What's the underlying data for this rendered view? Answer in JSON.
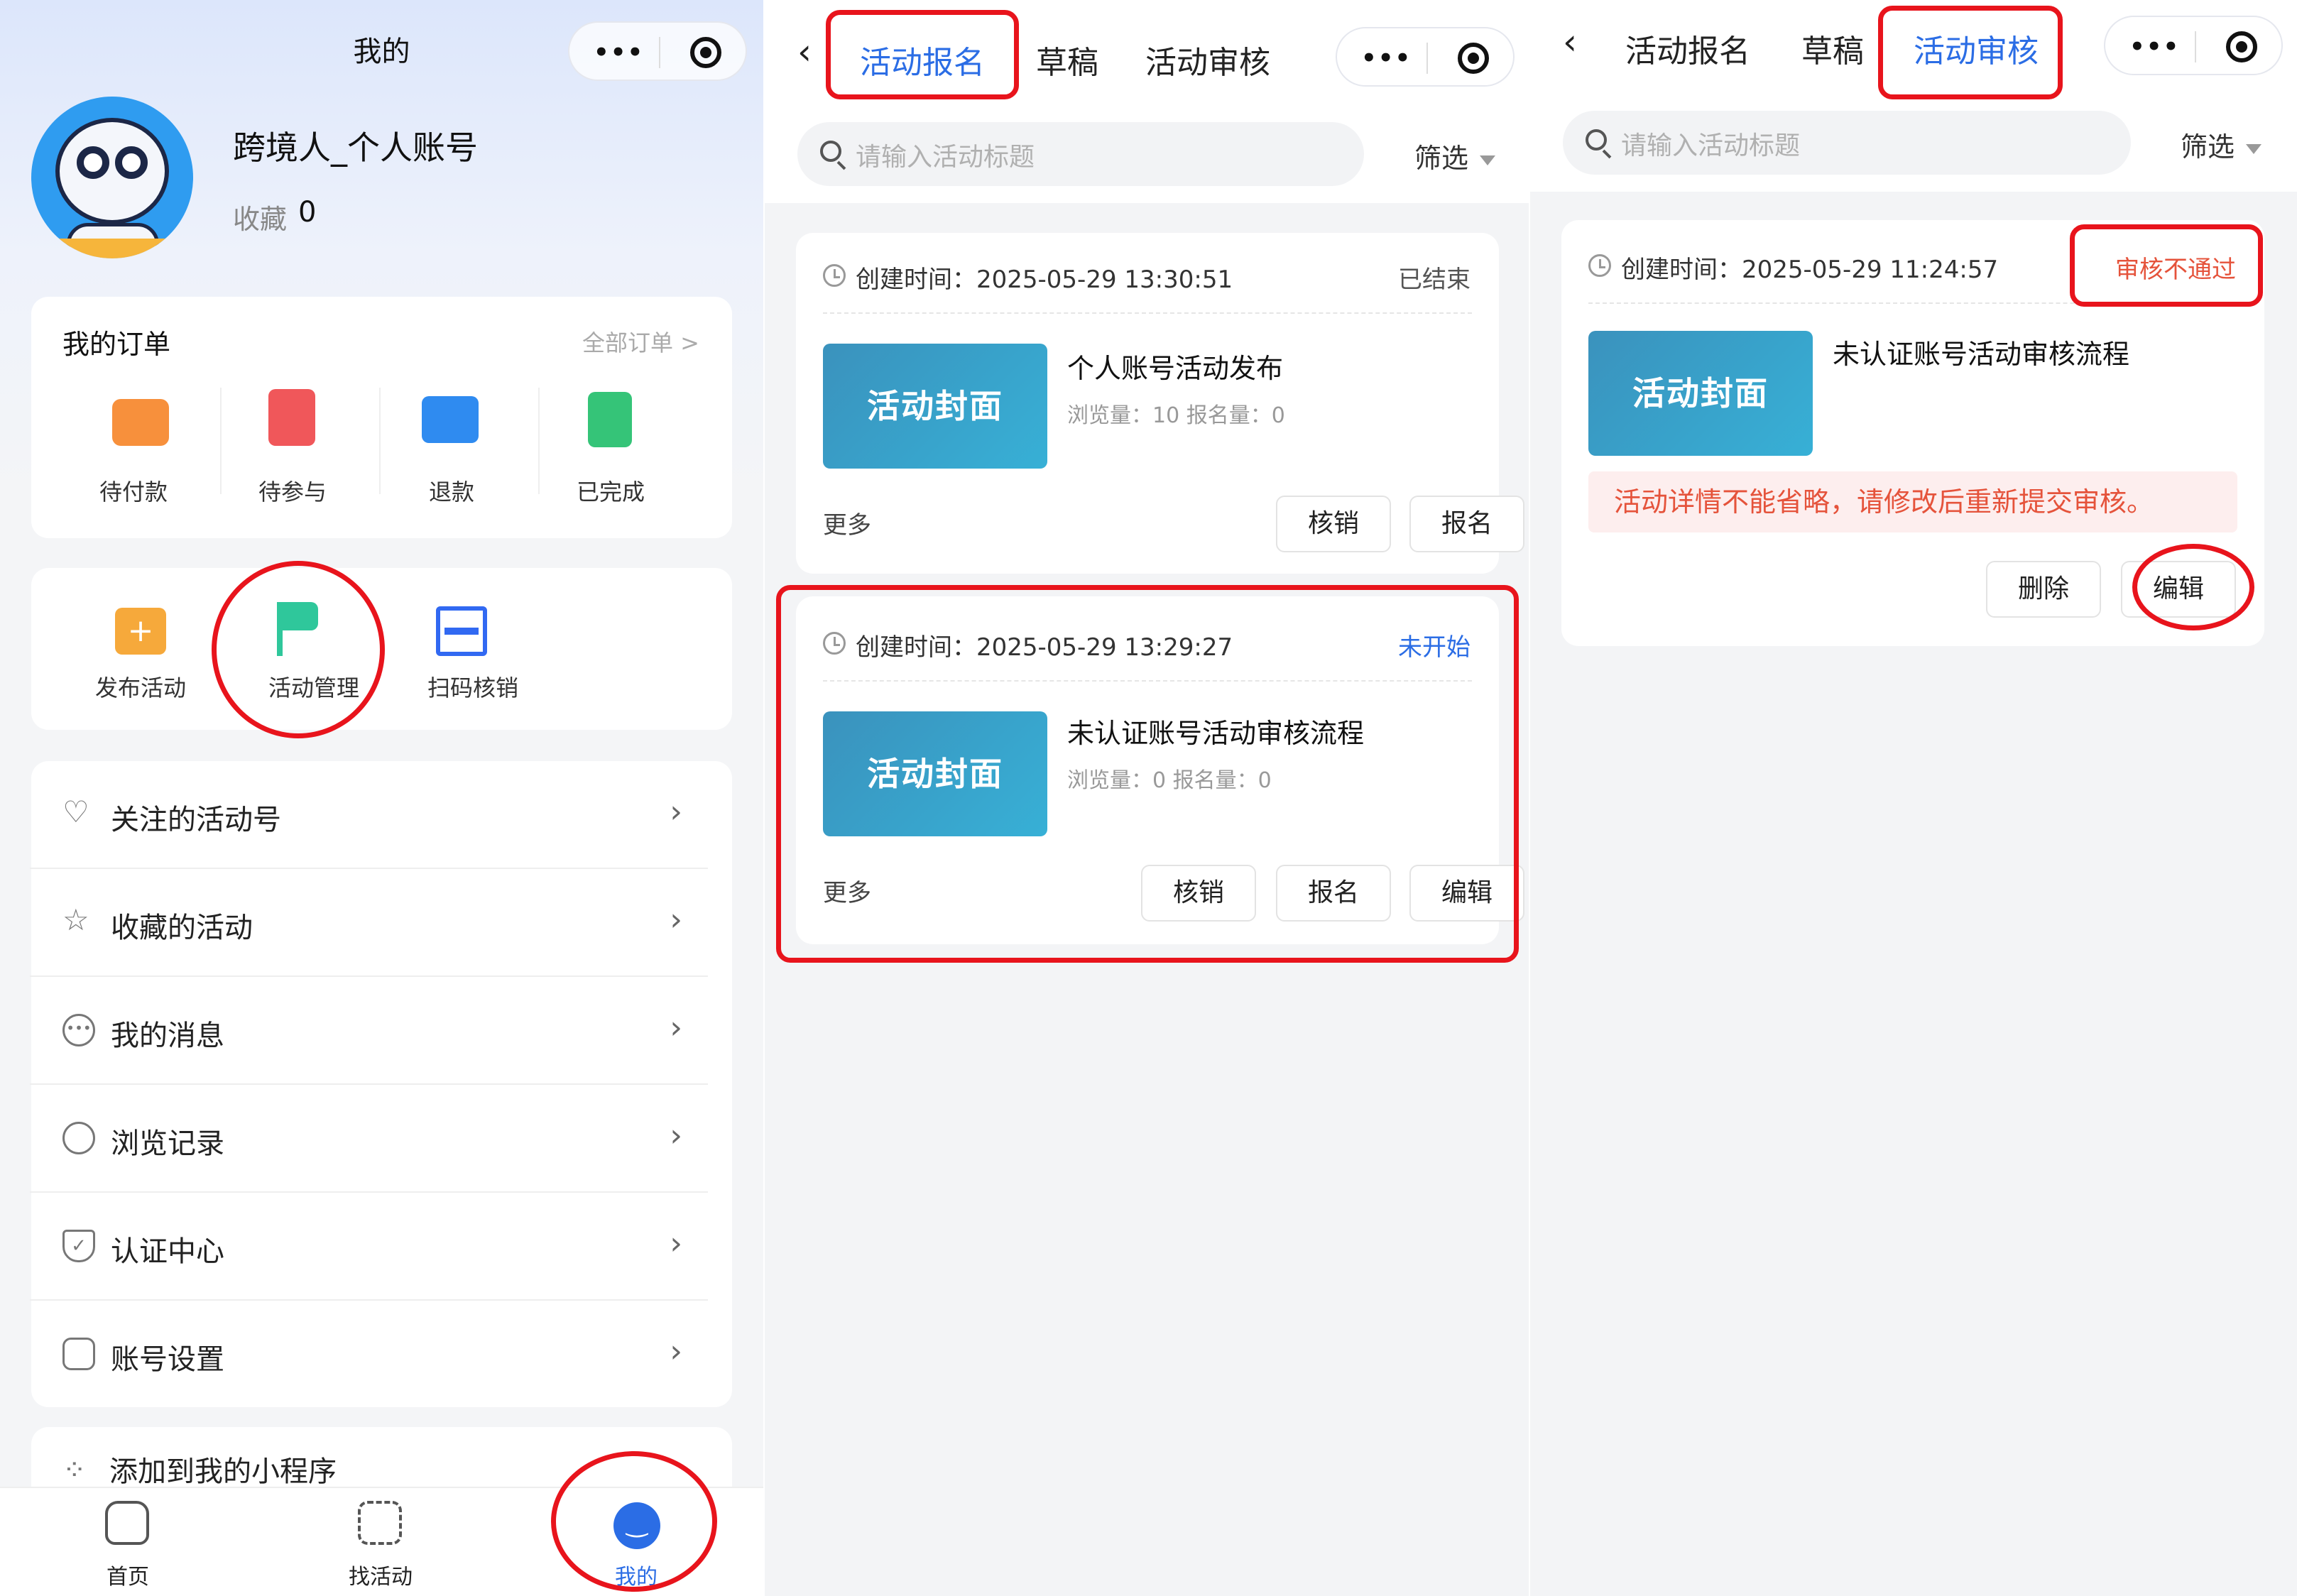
{
  "profile_page": {
    "title": "我的",
    "user": {
      "name": "跨境人_个人账号",
      "fav_label": "收藏",
      "fav_count": "0"
    },
    "orders": {
      "title": "我的订单",
      "all_link": "全部订单 >",
      "items": [
        {
          "label": "待付款",
          "icon": "wallet-icon",
          "color": "#f7903c"
        },
        {
          "label": "待参与",
          "icon": "ticket-icon",
          "color": "#f0575a"
        },
        {
          "label": "退款",
          "icon": "refund-card-icon",
          "color": "#2f8bf0"
        },
        {
          "label": "已完成",
          "icon": "check-clipboard-icon",
          "color": "#35c478"
        }
      ]
    },
    "tools": [
      {
        "label": "发布活动",
        "icon": "calendar-plus-icon",
        "color": "#f6a93b"
      },
      {
        "label": "活动管理",
        "icon": "flag-gear-icon",
        "color": "#2fc79b"
      },
      {
        "label": "扫码核销",
        "icon": "scan-icon",
        "color": "#3169f2"
      }
    ],
    "menu": [
      {
        "label": "关注的活动号",
        "icon": "heart-icon"
      },
      {
        "label": "收藏的活动",
        "icon": "star-icon"
      },
      {
        "label": "我的消息",
        "icon": "message-icon"
      },
      {
        "label": "浏览记录",
        "icon": "clock-icon"
      },
      {
        "label": "认证中心",
        "icon": "shield-icon"
      },
      {
        "label": "账号设置",
        "icon": "hexagon-gear-icon"
      }
    ],
    "mini_program": "添加到我的小程序",
    "bottom_nav": [
      {
        "label": "首页",
        "icon": "home-icon"
      },
      {
        "label": "找活动",
        "icon": "grid-icon"
      },
      {
        "label": "我的",
        "icon": "smile-icon",
        "active": true
      }
    ]
  },
  "activity_page": {
    "tabs": [
      "活动报名",
      "草稿",
      "活动审核"
    ],
    "search_placeholder": "请输入活动标题",
    "filter_label": "筛选",
    "cards": [
      {
        "created": "创建时间：2025-05-29 13:30:51",
        "status": "已结束",
        "cover": "活动封面",
        "title": "个人账号活动发布",
        "stats": "浏览量：10   报名量：0",
        "more": "更多",
        "buttons": [
          "核销",
          "报名"
        ]
      },
      {
        "created": "创建时间：2025-05-29 13:29:27",
        "status": "未开始",
        "cover": "活动封面",
        "title": "未认证账号活动审核流程",
        "stats": "浏览量：0   报名量：0",
        "more": "更多",
        "buttons": [
          "核销",
          "报名",
          "编辑"
        ]
      }
    ]
  },
  "review_page": {
    "tabs": [
      "活动报名",
      "草稿",
      "活动审核"
    ],
    "search_placeholder": "请输入活动标题",
    "filter_label": "筛选",
    "card": {
      "created": "创建时间：2025-05-29 11:24:57",
      "status": "审核不通过",
      "cover": "活动封面",
      "title": "未认证账号活动审核流程",
      "reject_reason": "活动详情不能省略，请修改后重新提交审核。",
      "buttons": [
        "删除",
        "编辑"
      ]
    }
  },
  "colors": {
    "accent": "#2b6de5",
    "danger": "#e8141c",
    "reject_text": "#e5533b"
  }
}
